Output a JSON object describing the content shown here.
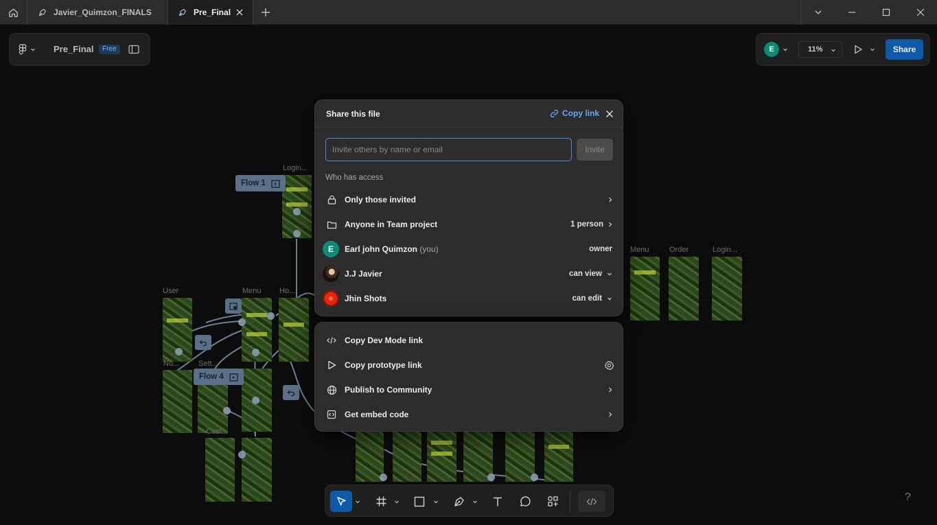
{
  "tabs": [
    {
      "label": "Javier_Quimzon_FINALS",
      "active": false
    },
    {
      "label": "Pre_Final",
      "active": true
    }
  ],
  "file": {
    "name": "Pre_Final",
    "plan_badge": "Free"
  },
  "header_right": {
    "avatar_initial": "E",
    "zoom": "11%",
    "share_label": "Share"
  },
  "canvas": {
    "frame_labels": [
      "Login...",
      "User",
      "Menu",
      "Ho...",
      "Menu",
      "Order",
      "Login...",
      "No...",
      "Sett...",
      "Cust..."
    ],
    "flow_tags": [
      "Flow 1",
      "Flow 4"
    ]
  },
  "share_dialog": {
    "title": "Share this file",
    "copy_link": "Copy link",
    "invite_placeholder": "Invite others by name or email",
    "invite_button": "Invite",
    "access_heading": "Who has access",
    "rows": [
      {
        "icon": "lock-icon",
        "label": "Only those invited",
        "right": ""
      },
      {
        "icon": "folder-icon",
        "label": "Anyone in Team project",
        "right": "1 person"
      },
      {
        "avatar": "E",
        "label": "Earl john Quimzon",
        "suffix": "(you)",
        "right": "owner"
      },
      {
        "avatar": "photo",
        "label": "J.J Javier",
        "right": "can view"
      },
      {
        "avatar": "flower",
        "label": "Jhin Shots",
        "right": "can edit"
      }
    ]
  },
  "more_menu": {
    "items": [
      {
        "icon": "code-icon",
        "label": "Copy Dev Mode link"
      },
      {
        "icon": "play-icon",
        "label": "Copy prototype link"
      },
      {
        "icon": "globe-icon",
        "label": "Publish to Community"
      },
      {
        "icon": "embed-icon",
        "label": "Get embed code"
      }
    ]
  },
  "help_label": "?",
  "colors": {
    "accent": "#0d5aa8",
    "link": "#6aa9ee",
    "focus": "#4d8fd8",
    "avatar": "#0f8a74"
  }
}
